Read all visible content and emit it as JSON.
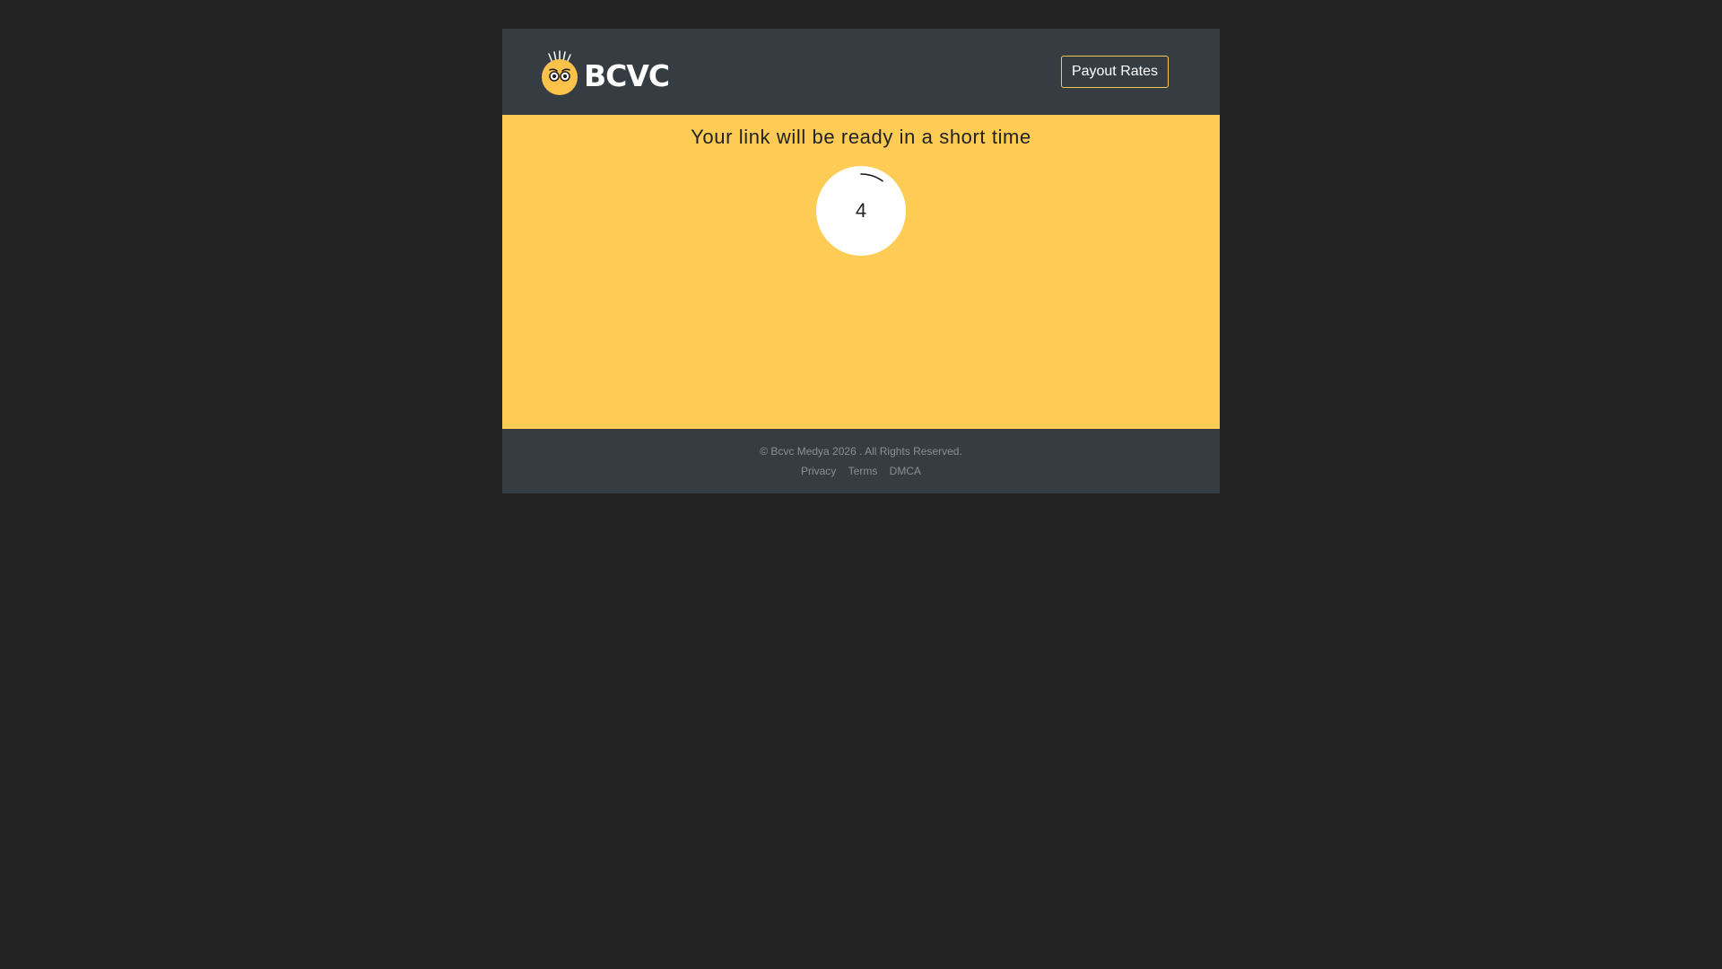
{
  "header": {
    "logo_text": "BCVC",
    "payout_button_label": "Payout Rates",
    "logo_icon": "bcvc-mascot-icon"
  },
  "main": {
    "title": "Your link will be ready in a short time",
    "countdown": "4",
    "countdown_progress_fraction": 0.1
  },
  "footer": {
    "copyright": "© Bcvc Medya 2026 . All Rights Reserved.",
    "links": [
      "Privacy",
      "Terms",
      "DMCA"
    ]
  },
  "colors": {
    "page_background": "#232323",
    "header_footer_background": "#353c42",
    "accent_yellow": "#fecc55",
    "button_border": "#f9c84f"
  }
}
